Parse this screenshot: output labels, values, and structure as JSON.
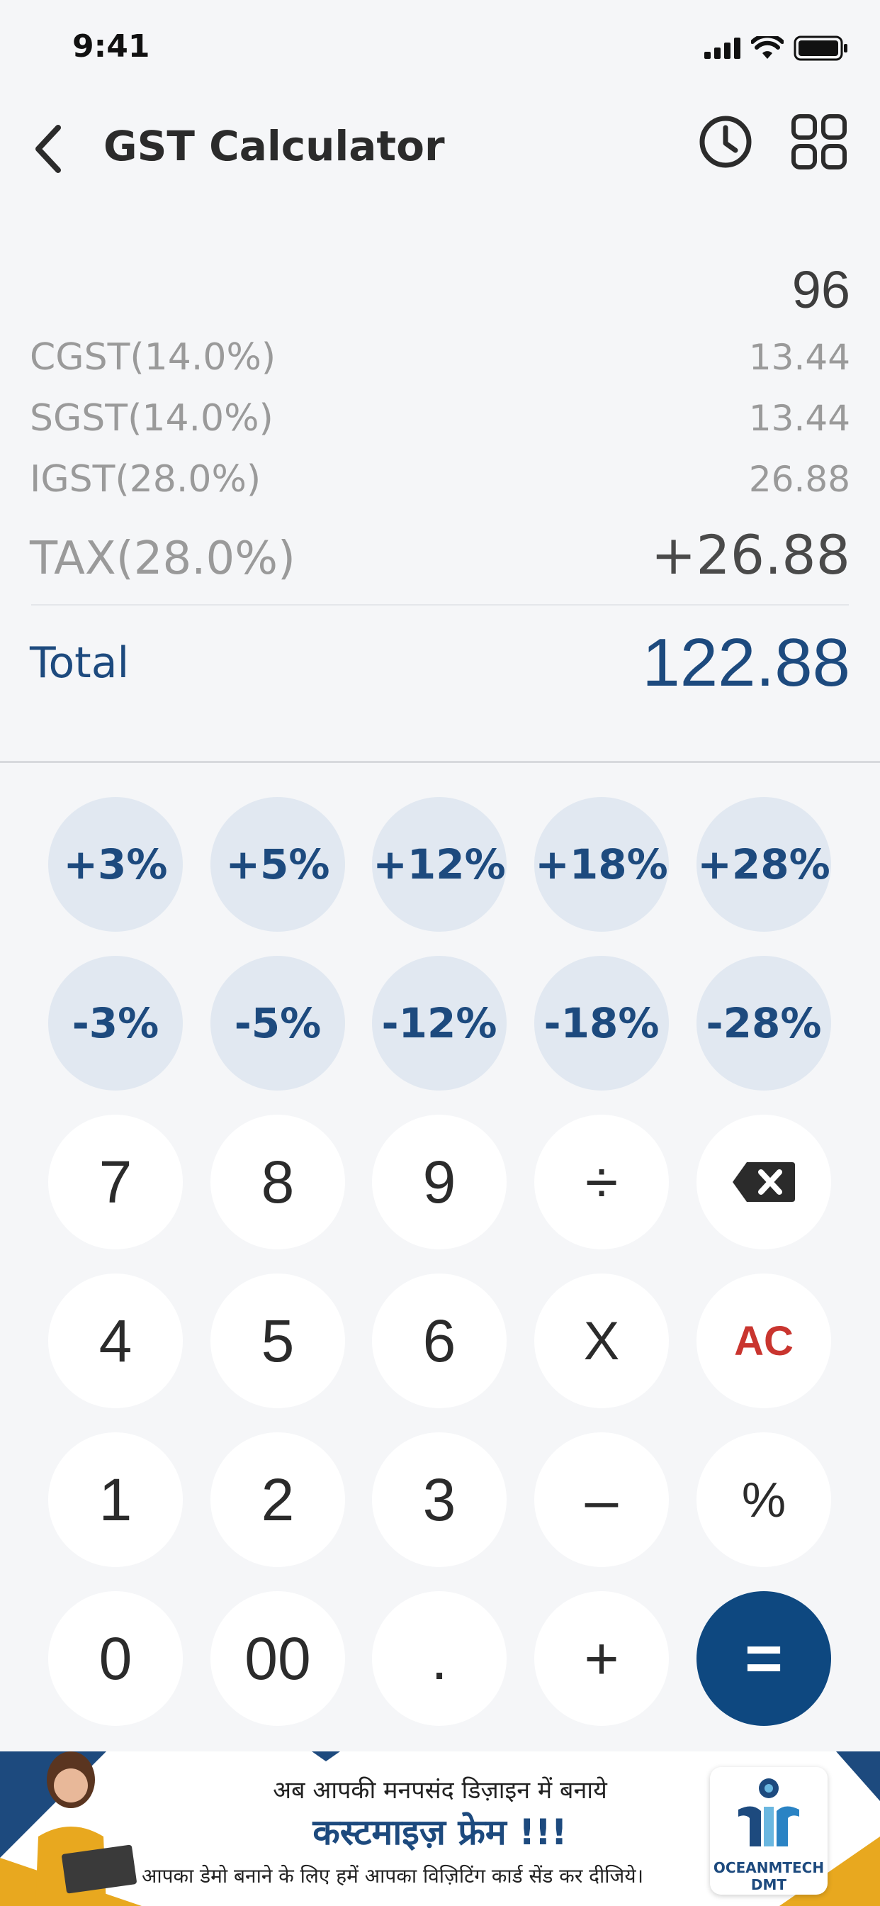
{
  "status_bar": {
    "time": "9:41"
  },
  "header": {
    "title": "GST Calculator"
  },
  "results": {
    "amount": "96",
    "cgst": {
      "label": "CGST(14.0%)",
      "value": "13.44"
    },
    "sgst": {
      "label": "SGST(14.0%)",
      "value": "13.44"
    },
    "igst": {
      "label": "IGST(28.0%)",
      "value": "26.88"
    },
    "tax": {
      "label": "TAX(28.0%)",
      "value": "+26.88"
    },
    "total": {
      "label": "Total",
      "value": "122.88"
    }
  },
  "keypad": {
    "add_rates": [
      "+3%",
      "+5%",
      "+12%",
      "+18%",
      "+28%"
    ],
    "sub_rates": [
      "-3%",
      "-5%",
      "-12%",
      "-18%",
      "-28%"
    ],
    "row3": [
      "7",
      "8",
      "9",
      "÷"
    ],
    "row4": [
      "4",
      "5",
      "6",
      "X",
      "AC"
    ],
    "row5": [
      "1",
      "2",
      "3",
      "–",
      "%"
    ],
    "row6": [
      "0",
      "00",
      ".",
      "+",
      "="
    ]
  },
  "banner": {
    "line1": "अब आपकी मनपसंद डिज़ाइन में बनाये",
    "line2": "कस्टमाइज़ फ्रेम !!!",
    "line3": "आपका डेमो बनाने के लिए हमें आपका विज़िटिंग कार्ड सेंड कर दीजिये।",
    "logo_text_1": "OCEANMTECH",
    "logo_text_2": "DMT"
  },
  "colors": {
    "accent": "#0e4880",
    "total_text": "#1d4a7e",
    "ac_red": "#c9352f",
    "pct_bg": "#e1e8f1"
  },
  "icons": [
    "back-chevron-icon",
    "history-clock-icon",
    "grid-icon",
    "backspace-icon"
  ]
}
